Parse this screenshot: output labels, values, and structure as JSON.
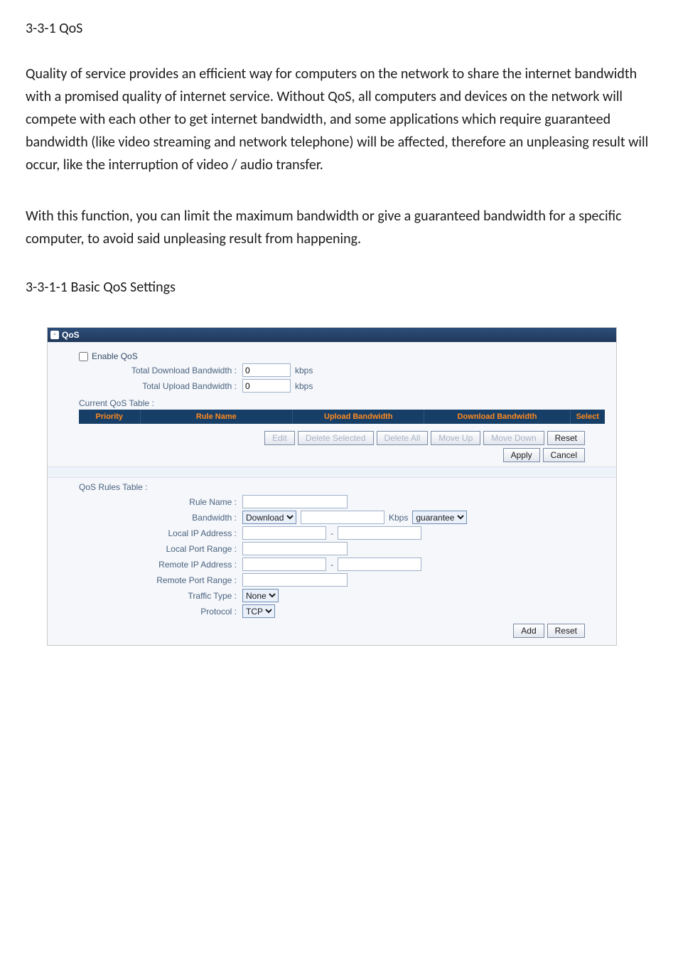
{
  "heading_331": "3-3-1 QoS",
  "para1": "Quality of service provides an efficient way for computers on the network to share the internet bandwidth with a promised quality of internet service. Without QoS, all computers and devices on the network will compete with each other to get internet bandwidth, and some applications which require guaranteed bandwidth (like video streaming and network telephone) will be affected, therefore an unpleasing result will occur, like the interruption of video / audio transfer.",
  "para2": "With this function, you can limit the maximum bandwidth or give a guaranteed bandwidth for a specific computer, to avoid said unpleasing result from happening.",
  "heading_3311": "3-3-1-1 Basic QoS Settings",
  "panel": {
    "title": "QoS",
    "enable_qos_label": "Enable QoS",
    "total_download_label": "Total Download Bandwidth :",
    "total_download_value": "0",
    "total_upload_label": "Total Upload Bandwidth :",
    "total_upload_value": "0",
    "kbps_unit": "kbps",
    "current_table_label": "Current QoS Table :",
    "th_priority": "Priority",
    "th_rulename": "Rule Name",
    "th_upload": "Upload Bandwidth",
    "th_download": "Download Bandwidth",
    "th_select": "Select",
    "btn_edit": "Edit",
    "btn_delete_selected": "Delete Selected",
    "btn_delete_all": "Delete All",
    "btn_move_up": "Move Up",
    "btn_move_down": "Move Down",
    "btn_reset": "Reset",
    "btn_apply": "Apply",
    "btn_cancel": "Cancel"
  },
  "rules": {
    "table_label": "QoS Rules Table :",
    "rule_name_label": "Rule Name :",
    "rule_name_value": "",
    "bandwidth_label": "Bandwidth :",
    "bandwidth_dir": "Download",
    "bandwidth_value": "",
    "bandwidth_unit": "Kbps",
    "bandwidth_mode": "guarantee",
    "local_ip_label": "Local IP Address :",
    "local_ip_from": "",
    "local_ip_to": "",
    "local_port_label": "Local Port Range :",
    "local_port_value": "",
    "remote_ip_label": "Remote IP Address :",
    "remote_ip_from": "",
    "remote_ip_to": "",
    "remote_port_label": "Remote Port Range :",
    "remote_port_value": "",
    "traffic_type_label": "Traffic Type :",
    "traffic_type_value": "None",
    "protocol_label": "Protocol :",
    "protocol_value": "TCP",
    "btn_add": "Add",
    "btn_reset": "Reset"
  }
}
